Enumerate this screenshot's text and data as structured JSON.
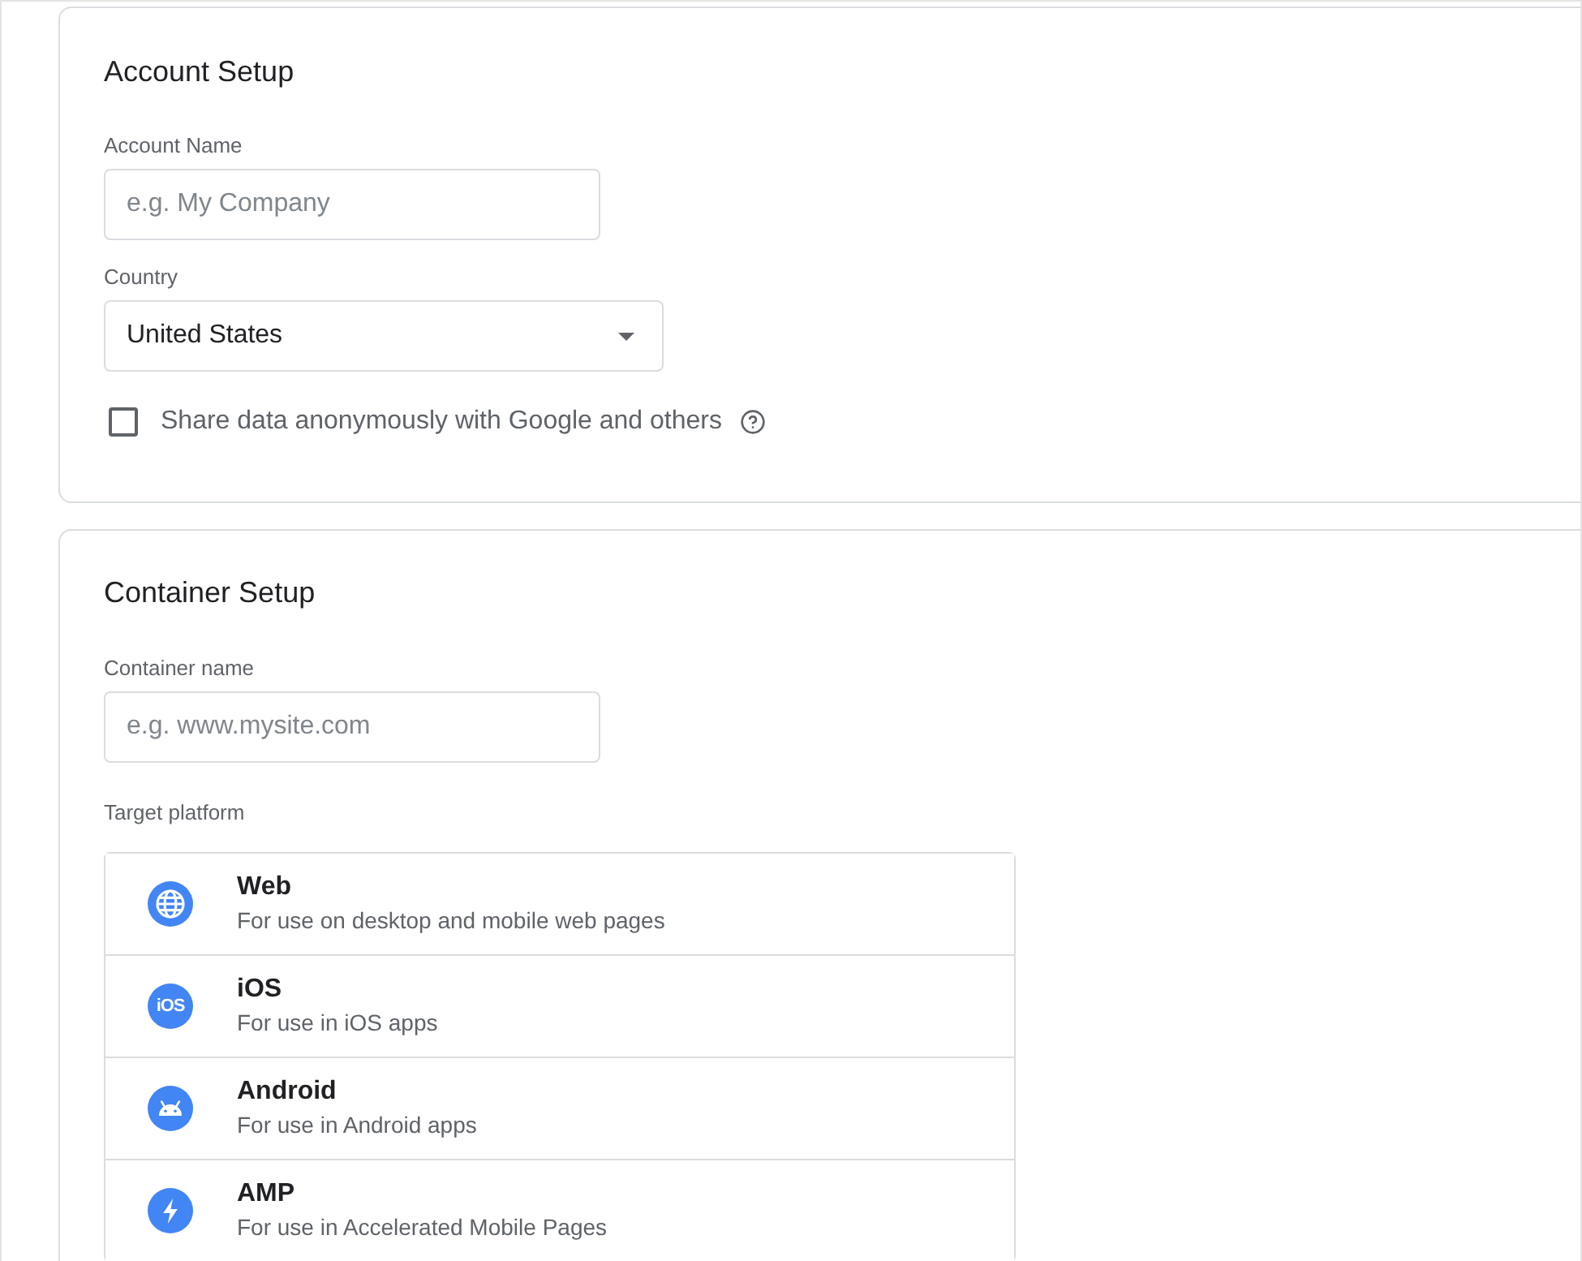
{
  "account_setup": {
    "title": "Account Setup",
    "account_name": {
      "label": "Account Name",
      "placeholder": "e.g. My Company"
    },
    "country": {
      "label": "Country",
      "value": "United States"
    },
    "share_data": {
      "label": "Share data anonymously with Google and others",
      "checked": false
    }
  },
  "container_setup": {
    "title": "Container Setup",
    "container_name": {
      "label": "Container name",
      "placeholder": "e.g. www.mysite.com"
    },
    "target_platform": {
      "label": "Target platform",
      "options": [
        {
          "kind": "web",
          "name": "Web",
          "description": "For use on desktop and mobile web pages",
          "selected": false
        },
        {
          "kind": "ios",
          "icon_text": "iOS",
          "name": "iOS",
          "description": "For use in iOS apps",
          "selected": false
        },
        {
          "kind": "android",
          "name": "Android",
          "description": "For use in Android apps",
          "selected": false
        },
        {
          "kind": "amp",
          "name": "AMP",
          "description": "For use in Accelerated Mobile Pages",
          "selected": false
        }
      ]
    }
  }
}
